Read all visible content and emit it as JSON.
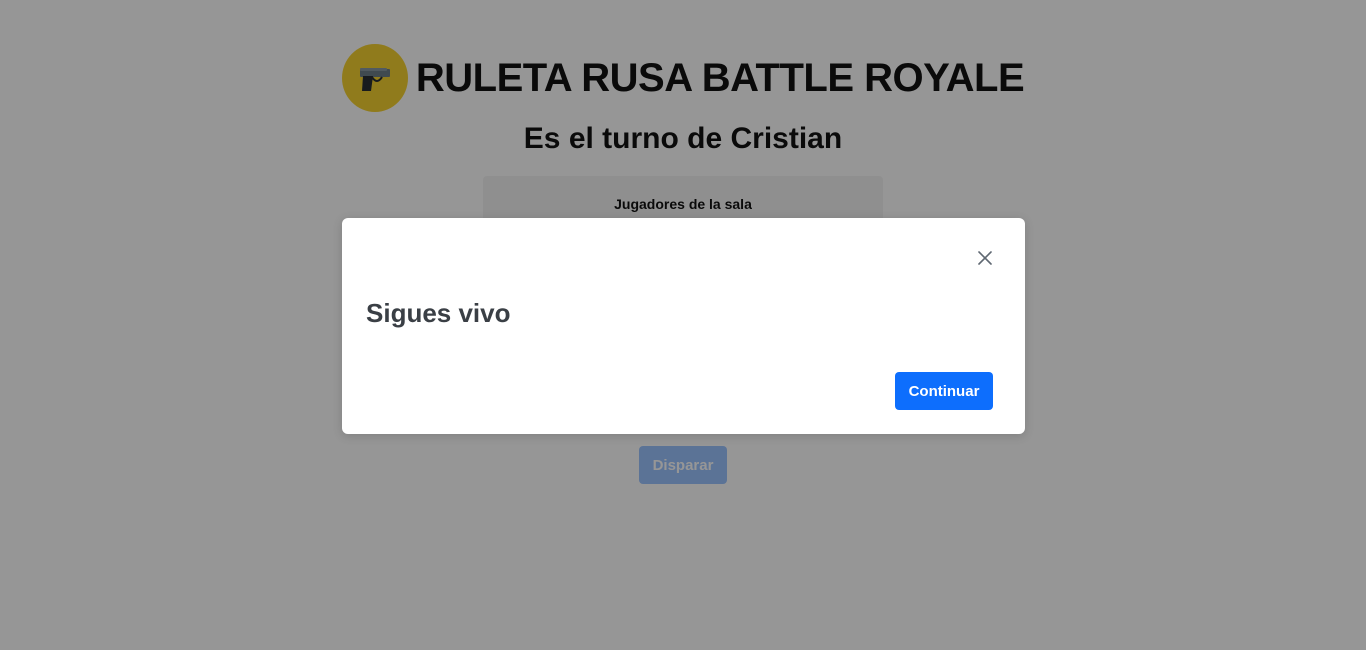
{
  "header": {
    "logo_icon": "pistol-icon",
    "title": "RULETA RUSA BATTLE ROYALE"
  },
  "turn": {
    "title": "Es el turno de Cristian"
  },
  "players_panel": {
    "heading": "Jugadores de la sala"
  },
  "actions": {
    "shoot_label": "Disparar"
  },
  "modal": {
    "title": "Sigues vivo",
    "close_icon": "close-icon",
    "continue_label": "Continuar"
  },
  "colors": {
    "logo_background": "#f5d130",
    "primary": "#0d6efd",
    "backdrop": "rgba(0,0,0,0.41)"
  }
}
